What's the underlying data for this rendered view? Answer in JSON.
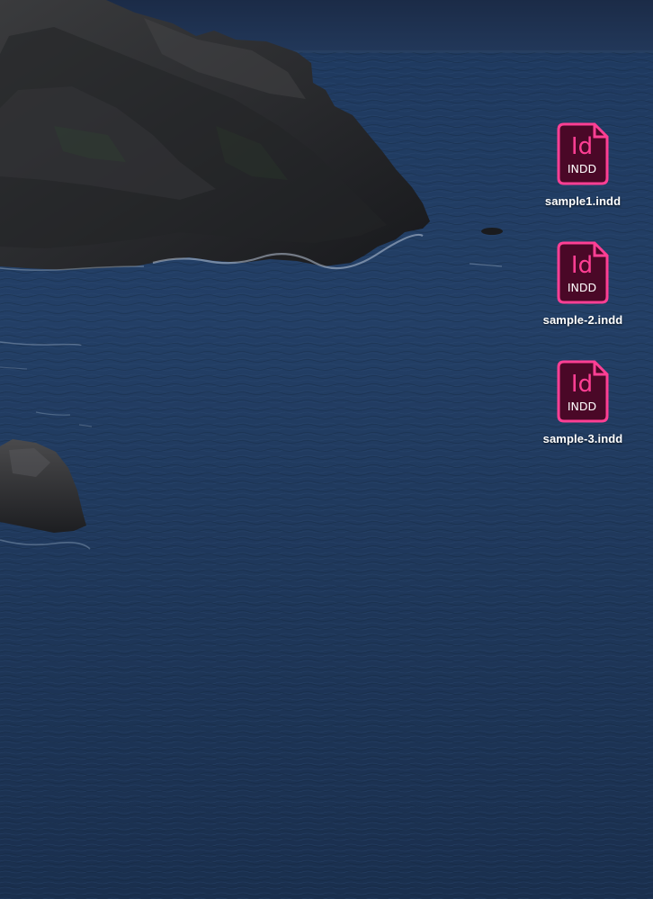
{
  "desktop": {
    "accent_color": "#ff3f94",
    "icon_fill_color": "#4a0827",
    "files": [
      {
        "name": "sample1.indd",
        "icon": "indesign-document-icon",
        "app_mark": "Id",
        "type_label": "INDD"
      },
      {
        "name": "sample-2.indd",
        "icon": "indesign-document-icon",
        "app_mark": "Id",
        "type_label": "INDD"
      },
      {
        "name": "sample-3.indd",
        "icon": "indesign-document-icon",
        "app_mark": "Id",
        "type_label": "INDD"
      }
    ]
  }
}
